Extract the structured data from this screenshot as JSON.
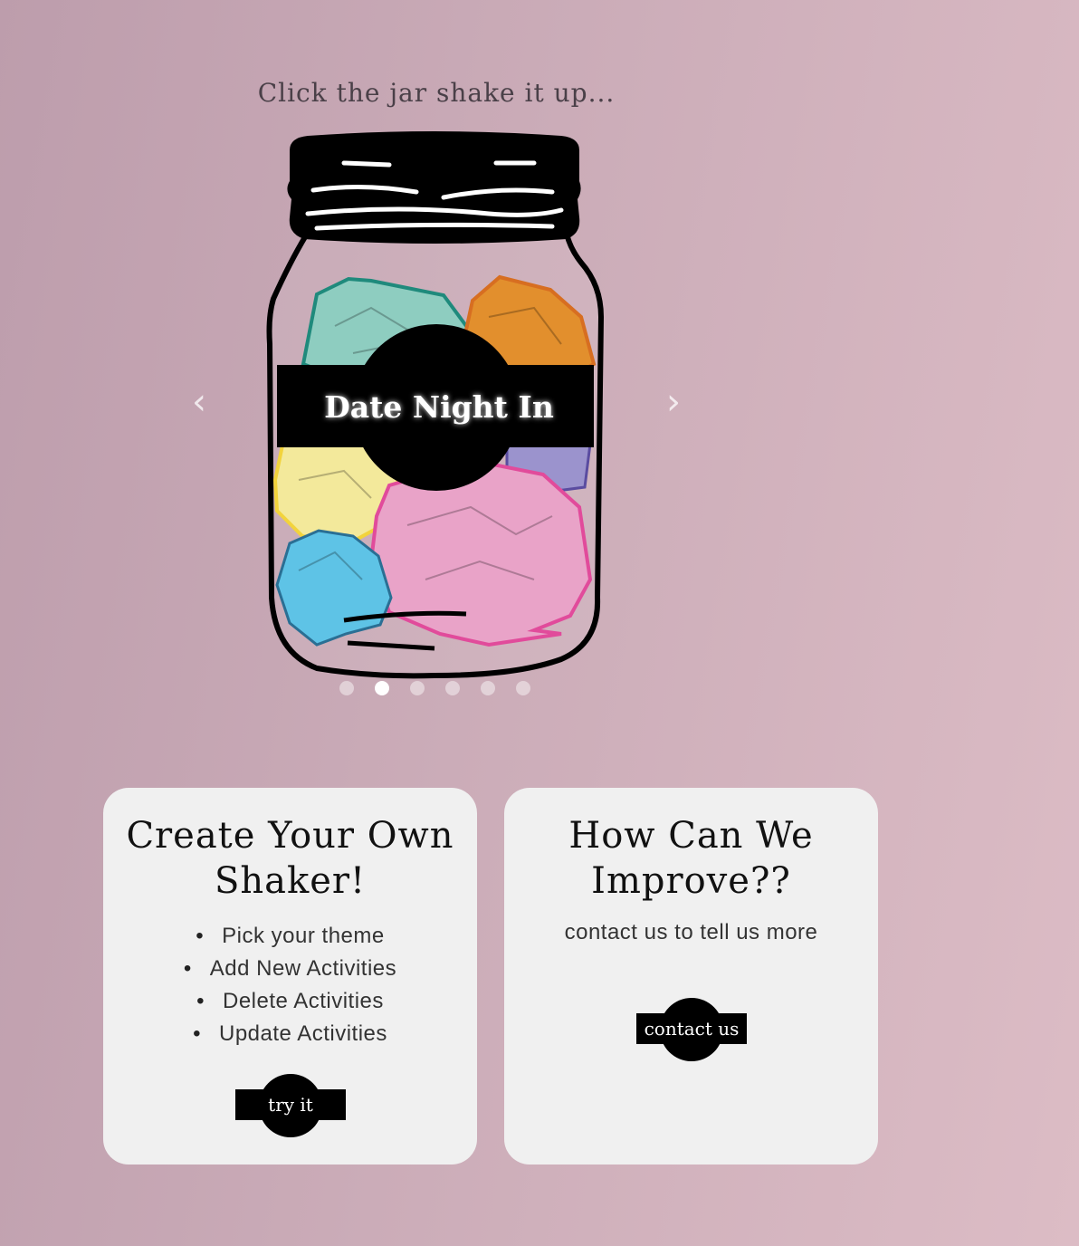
{
  "hint_text": "Click the jar shake it up...",
  "carousel": {
    "current_label": "Date Night In",
    "prev_icon": "chevron-left-icon",
    "next_icon": "chevron-right-icon",
    "prev_glyph": "‹",
    "next_glyph": "›",
    "slide_count": 6,
    "active_index": 1
  },
  "cards": {
    "create": {
      "title": "Create Your Own Shaker!",
      "items": [
        "Pick your theme",
        "Add New Activities",
        "Delete Activities",
        "Update Activities"
      ],
      "button_label": "try it"
    },
    "improve": {
      "title": "How Can We Improve??",
      "text": "contact us to tell us more",
      "button_label": "contact us"
    }
  },
  "colors": {
    "background_start": "#bd9dac",
    "background_end": "#dcbcc5",
    "card_bg": "#f0f0f0",
    "paper_teal": "#8ecdc0",
    "paper_orange": "#e28f2d",
    "paper_yellow": "#f3e99b",
    "paper_purple": "#9b93cd",
    "paper_pink": "#e9a3c8",
    "paper_blue": "#5ec3e6"
  }
}
